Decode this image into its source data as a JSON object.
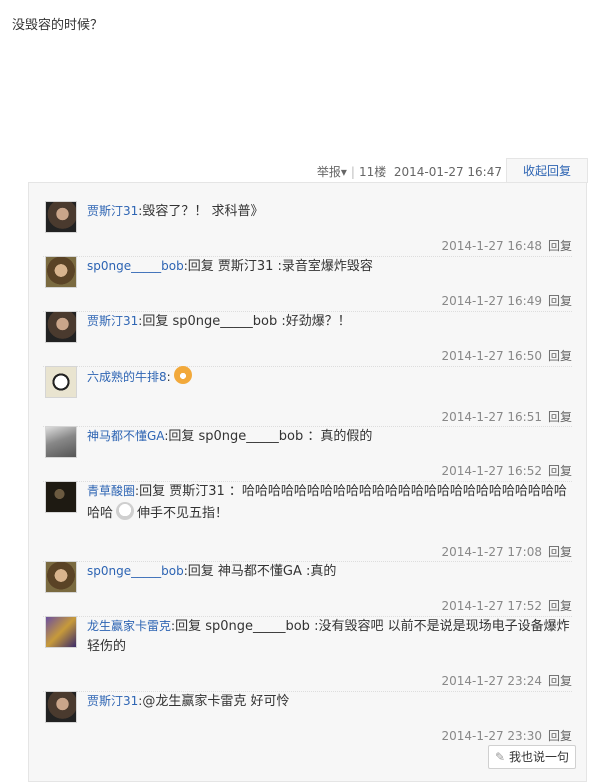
{
  "post": {
    "text": "没毁容的时候？"
  },
  "meta": {
    "report_label": "举报",
    "report_arrow": "▾",
    "separator": "|",
    "floor": "11楼",
    "timestamp": "2014-01-27 16:47",
    "collapse_label": "收起回复"
  },
  "replies": [
    {
      "user": "贾斯汀31",
      "avatar": "avatar-man-dark",
      "segments": [
        {
          "t": "毁容了？！ 求科普》"
        }
      ],
      "time": "2014-1-27 16:48",
      "reply_label": "回复"
    },
    {
      "user": "sp0nge_____bob",
      "avatar": "avatar-man-long-hair",
      "segments": [
        {
          "t": "回复 贾斯汀31 :录音室爆炸毁容"
        }
      ],
      "time": "2014-1-27 16:49",
      "reply_label": "回复"
    },
    {
      "user": "贾斯汀31",
      "avatar": "avatar-man-dark",
      "segments": [
        {
          "t": "回复 sp0nge_____bob :好劲爆？！"
        }
      ],
      "time": "2014-1-27 16:50",
      "reply_label": "回复"
    },
    {
      "user": "六成熟的牛排8",
      "avatar": "avatar-cartoon-face",
      "segments": [
        {
          "emoji": "embarrassed-face-emoji"
        }
      ],
      "time": "2014-1-27 16:51",
      "reply_label": "回复"
    },
    {
      "user": "神马都不懂GA",
      "avatar": "avatar-statue",
      "segments": [
        {
          "t": "回复 sp0nge_____bob ：真的假的"
        }
      ],
      "time": "2014-1-27 16:52",
      "reply_label": "回复"
    },
    {
      "user": "青草酸圈",
      "avatar": "avatar-dark-photo",
      "segments": [
        {
          "t": "回复 贾斯汀31 ：哈哈哈哈哈哈哈哈哈哈哈哈哈哈哈哈哈哈哈哈哈哈哈哈哈哈哈"
        },
        {
          "emoji": "ghost-emoji"
        },
        {
          "t": "伸手不见五指！"
        }
      ],
      "time": "2014-1-27 17:08",
      "reply_label": "回复"
    },
    {
      "user": "sp0nge_____bob",
      "avatar": "avatar-man-long-hair",
      "segments": [
        {
          "t": "回复 神马都不懂GA :真的"
        }
      ],
      "time": "2014-1-27 17:52",
      "reply_label": "回复"
    },
    {
      "user": "龙生赢家卡雷克",
      "avatar": "avatar-colorful",
      "segments": [
        {
          "t": "回复 sp0nge_____bob :没有毁容吧 以前不是说是现场电子设备爆炸轻伤的"
        }
      ],
      "time": "2014-1-27 23:24",
      "reply_label": "回复"
    },
    {
      "user": "贾斯汀31",
      "avatar": "avatar-man-dark",
      "segments": [
        {
          "t": "@龙生赢家卡雷克 好可怜"
        }
      ],
      "time": "2014-1-27 23:30",
      "reply_label": "回复"
    }
  ],
  "say_button": {
    "icon": "pen-icon",
    "glyph": "✎",
    "label": "我也说一句"
  },
  "colors": {
    "link": "#2d64b3",
    "box_bg": "#f7f7f7",
    "border": "#e5e5e5"
  }
}
